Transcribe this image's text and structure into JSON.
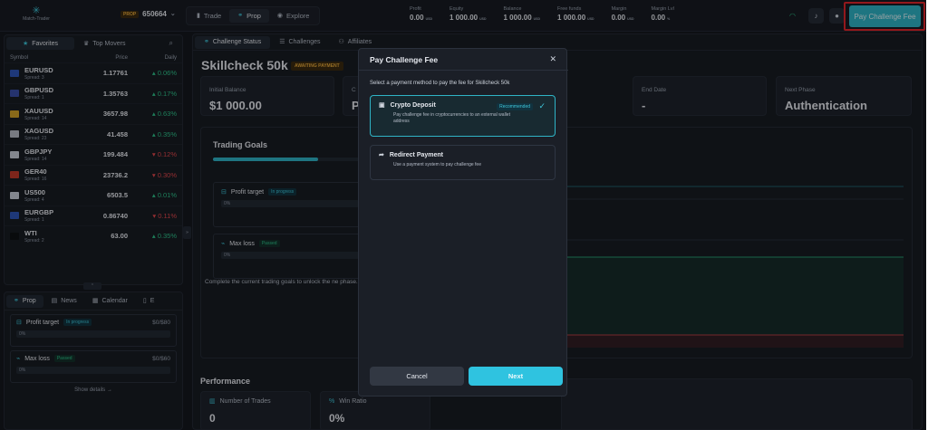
{
  "brand": {
    "name": "Match-Trader"
  },
  "account": {
    "badge": "PROP",
    "number": "650664"
  },
  "nav": {
    "tabs": [
      "Trade",
      "Prop",
      "Explore"
    ],
    "active": "Prop"
  },
  "stats": [
    {
      "label": "Profit",
      "value": "0.00",
      "currency": "USD"
    },
    {
      "label": "Equity",
      "value": "1 000.00",
      "currency": "USD"
    },
    {
      "label": "Balance",
      "value": "1 000.00",
      "currency": "USD"
    },
    {
      "label": "Free funds",
      "value": "1 000.00",
      "currency": "USD"
    },
    {
      "label": "Margin",
      "value": "0.00",
      "currency": "USD"
    },
    {
      "label": "Margin Lvl",
      "value": "0.00",
      "currency": "%"
    }
  ],
  "header": {
    "pay_button": "Pay Challenge Fee"
  },
  "left": {
    "tabs": [
      "Favorites",
      "Top Movers"
    ],
    "columns": [
      "Symbol",
      "Price",
      "Daily"
    ],
    "instruments": [
      {
        "symbol": "EURUSD",
        "spread": "Spread: 3",
        "price": "1.17761",
        "change": "0.06%",
        "dir": "up",
        "flag": "#2e56b8"
      },
      {
        "symbol": "GBPUSD",
        "spread": "Spread: 1",
        "price": "1.35763",
        "change": "0.17%",
        "dir": "up",
        "flag": "#3a4fa8"
      },
      {
        "symbol": "XAUUSD",
        "spread": "Spread: 14",
        "price": "3657.98",
        "change": "0.63%",
        "dir": "up",
        "flag": "#d2a229"
      },
      {
        "symbol": "XAGUSD",
        "spread": "Spread: 23",
        "price": "41.458",
        "change": "0.35%",
        "dir": "up",
        "flag": "#b8bec8"
      },
      {
        "symbol": "GBPJPY",
        "spread": "Spread: 14",
        "price": "199.484",
        "change": "0.12%",
        "dir": "down",
        "flag": "#c9d0db"
      },
      {
        "symbol": "GER40",
        "spread": "Spread: 16",
        "price": "23736.2",
        "change": "0.30%",
        "dir": "down",
        "flag": "#c23a2a"
      },
      {
        "symbol": "US500",
        "spread": "Spread: 4",
        "price": "6503.5",
        "change": "0.01%",
        "dir": "up",
        "flag": "#c9d0db"
      },
      {
        "symbol": "EURGBP",
        "spread": "Spread: 1",
        "price": "0.86740",
        "change": "0.11%",
        "dir": "down",
        "flag": "#2e56b8"
      },
      {
        "symbol": "WTI",
        "spread": "Spread: 2",
        "price": "63.00",
        "change": "0.35%",
        "dir": "up",
        "flag": "#0f1115"
      }
    ]
  },
  "bottom": {
    "tabs": [
      "Prop",
      "News",
      "Calendar",
      "E"
    ],
    "goals": [
      {
        "title": "Profit target",
        "badge": "In progress",
        "amount": "$0/$80",
        "progress": "0%"
      },
      {
        "title": "Max loss",
        "badge": "Passed",
        "amount": "$0/$60",
        "progress": "0%"
      }
    ],
    "show_details": "Show details →"
  },
  "main": {
    "tabs": [
      "Challenge Status",
      "Challenges",
      "Affiliates"
    ],
    "title": "Skillcheck 50k",
    "status_badge": "AWAITING PAYMENT",
    "cards": [
      {
        "label": "Initial Balance",
        "value": "$1 000.00"
      },
      {
        "label": "C",
        "value": "P"
      },
      {
        "label": "End Date",
        "value": "-"
      },
      {
        "label": "Next Phase",
        "value": "Authentication"
      }
    ],
    "goals_title": "Trading Goals",
    "goals": [
      {
        "title": "Profit target",
        "badge": "In progress",
        "progress": "0%"
      },
      {
        "title": "Max loss",
        "badge": "Passed",
        "progress": "0%"
      }
    ],
    "note": "Complete the current trading goals to unlock the ne phase.",
    "performance_title": "Performance",
    "performance": [
      {
        "label": "Number of Trades",
        "value": "0"
      },
      {
        "label": "Win Ratio",
        "value": "0%"
      }
    ]
  },
  "modal": {
    "title": "Pay Challenge Fee",
    "description": "Select a payment method to pay the fee for Skillcheck 50k",
    "options": [
      {
        "title": "Crypto Deposit",
        "badge": "Recommended",
        "desc": "Pay challenge fee in cryptocurrencies to an external wallet address",
        "selected": true
      },
      {
        "title": "Redirect Payment",
        "desc": "Use a payment system to pay challenge fee",
        "selected": false
      }
    ],
    "cancel": "Cancel",
    "next": "Next"
  }
}
